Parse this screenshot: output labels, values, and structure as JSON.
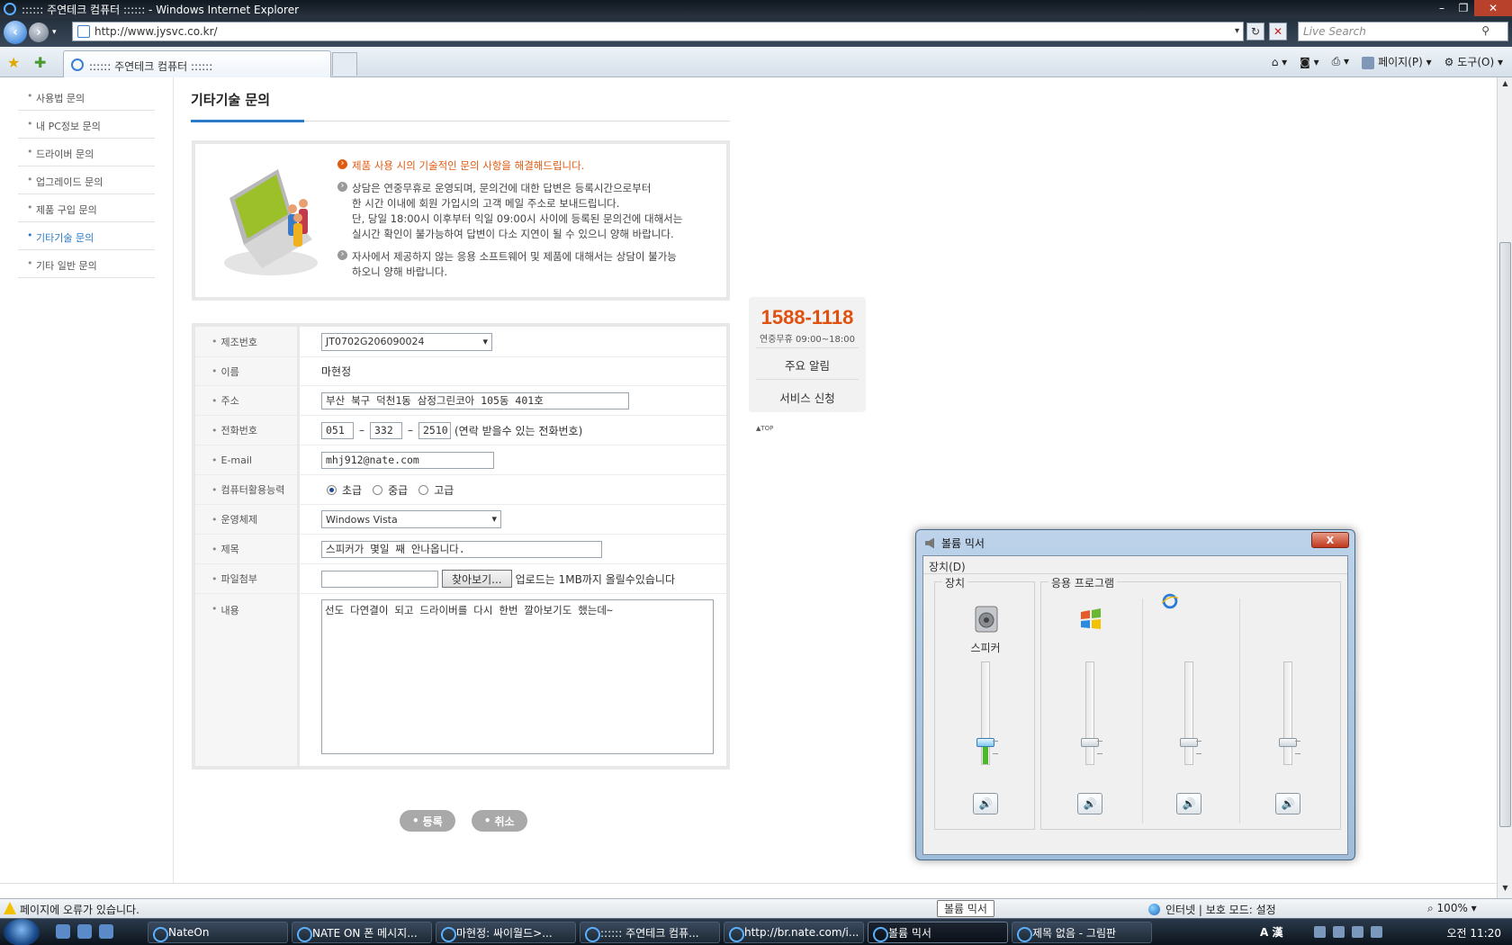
{
  "window": {
    "title": ":::::: 주연테크 컴퓨터 :::::: - Windows Internet Explorer",
    "minimize": "–",
    "maximize": "❐",
    "close": "✕"
  },
  "address": {
    "url": "http://www.jysvc.co.kr/",
    "search_placeholder": "Live Search"
  },
  "tab": {
    "label": ":::::: 주연테크 컴퓨터 ::::::"
  },
  "commandbar": {
    "page": "페이지(P)",
    "tools": "도구(O)"
  },
  "sidebar": {
    "items": [
      {
        "label": "사용법 문의"
      },
      {
        "label": "내 PC정보 문의"
      },
      {
        "label": "드라이버 문의"
      },
      {
        "label": "업그레이드 문의"
      },
      {
        "label": "제품 구입 문의"
      },
      {
        "label": "기타기술 문의"
      },
      {
        "label": "기타 일반 문의"
      }
    ],
    "active_index": 5
  },
  "page": {
    "title": "기타기술 문의"
  },
  "info": {
    "line1": "제품 사용 시의 기술적인 문의 사항을 해결해드립니다.",
    "line2": [
      "상담은 연중무휴로 운영되며, 문의건에 대한 답변은 등록시간으로부터",
      "한 시간 이내에 회원 가입시의 고객 메일 주소로 보내드립니다.",
      "단, 당일 18:00시 이후부터 익일 09:00시 사이에 등록된 문의건에 대해서는",
      "실시간 확인이 불가능하여 답변이 다소 지연이 될 수 있으니 양해 바랍니다."
    ],
    "line3": [
      "자사에서 제공하지 않는 응용 소프트웨어 및 제품에 대해서는 상담이 불가능",
      "하오니 양해 바랍니다."
    ]
  },
  "form": {
    "serial": {
      "label": "제조번호",
      "value": "JT0702G206090024"
    },
    "name": {
      "label": "이름",
      "value": "마현정"
    },
    "address": {
      "label": "주소",
      "value": "부산 북구 덕천1동  삼정그린코아 105동 401호"
    },
    "phone": {
      "label": "전화번호",
      "p1": "051",
      "p2": "332",
      "p3": "2510",
      "dash": "–",
      "note": "(연락 받을수 있는 전화번호)"
    },
    "email": {
      "label": "E-mail",
      "value": "mhj912@nate.com"
    },
    "skill": {
      "label": "컴퓨터활용능력",
      "options": [
        "초급",
        "중급",
        "고급"
      ],
      "selected": 0
    },
    "os": {
      "label": "운영체제",
      "value": "Windows Vista"
    },
    "subject": {
      "label": "제목",
      "value": "스피커가 몇일 째 안나옵니다."
    },
    "file": {
      "label": "파일첨부",
      "browse": "찾아보기...",
      "note": "업로드는 1MB까지 올릴수있습니다"
    },
    "content": {
      "label": "내용",
      "value": "선도 다연결이 되고 드라이버를 다시 한번 깔아보기도 했는데~"
    }
  },
  "actions": {
    "submit": "등록",
    "cancel": "취소"
  },
  "contact": {
    "phone": "1588-1118",
    "hours": "연중무휴 09:00~18:00",
    "notice": "주요 알림",
    "service": "서비스 신청",
    "top": "▲TOP"
  },
  "mixer": {
    "title": "볼륨 믹서",
    "close": "X",
    "menu": "장치(D)",
    "group_device": "장치",
    "group_apps": "응용 프로그램",
    "device_name": "스피커",
    "levels": [
      0.22,
      0.22,
      0.22,
      0.22
    ]
  },
  "statusbar": {
    "message": "페이지에 오류가 있습니다.",
    "tooltip": "볼륨 믹서",
    "zone": "인터넷 | 보호 모드: 설정",
    "zoom": "100%"
  },
  "taskbar": {
    "tasks": [
      "NateOn",
      "NATE ON 폰 메시지...",
      "마현정: 싸이월드>...",
      ":::::: 주연테크 컴퓨...",
      "http://br.nate.com/i...",
      "볼륨 믹서",
      "제목 없음 - 그림판"
    ],
    "active_index": 5,
    "ime": "A 漢",
    "clock": "오전 11:20"
  }
}
